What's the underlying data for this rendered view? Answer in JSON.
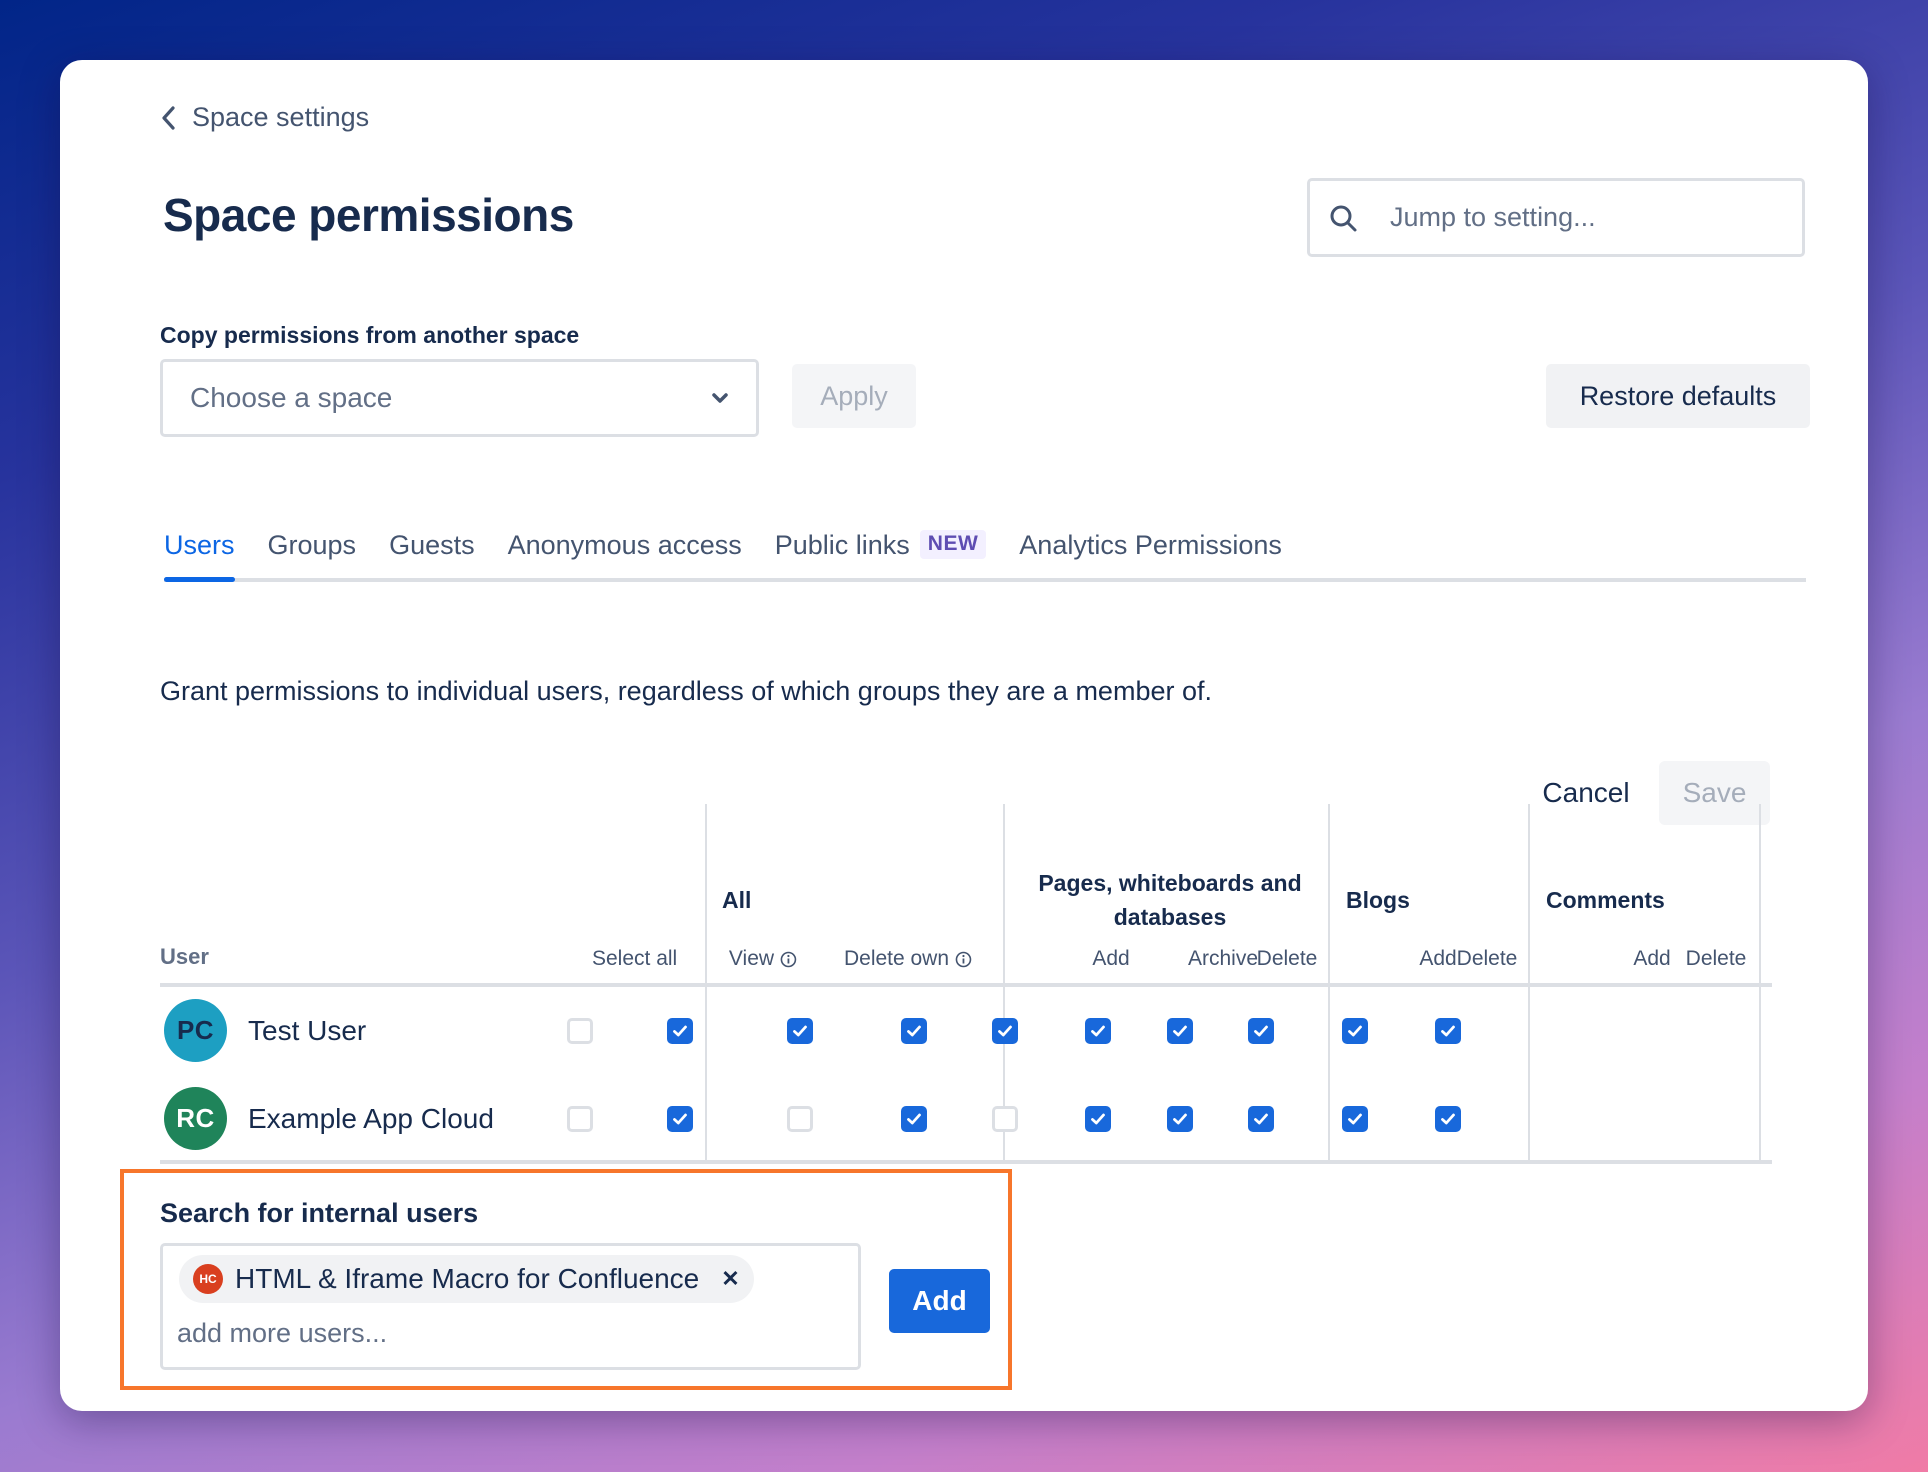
{
  "header": {
    "back_label": "Space settings",
    "title": "Space permissions",
    "search_placeholder": "Jump to setting..."
  },
  "copy_permissions": {
    "label": "Copy permissions from another space",
    "select_placeholder": "Choose a space",
    "apply_label": "Apply",
    "restore_label": "Restore defaults"
  },
  "tabs": [
    {
      "label": "Users",
      "active": true
    },
    {
      "label": "Groups",
      "active": false
    },
    {
      "label": "Guests",
      "active": false
    },
    {
      "label": "Anonymous access",
      "active": false
    },
    {
      "label": "Public links",
      "badge": "NEW",
      "active": false
    },
    {
      "label": "Analytics Permissions",
      "active": false
    }
  ],
  "description": "Grant permissions to individual users, regardless of which groups they are a member of.",
  "actions": {
    "cancel_label": "Cancel",
    "save_label": "Save"
  },
  "table": {
    "user_header": "User",
    "select_all_label": "Select all",
    "groups": [
      {
        "label": "All",
        "columns": [
          "View",
          "Delete own"
        ]
      },
      {
        "label": "Pages, whiteboards and databases",
        "columns": [
          "Add",
          "Archive",
          "Delete"
        ]
      },
      {
        "label": "Blogs",
        "columns": [
          "Add",
          "Delete"
        ]
      },
      {
        "label": "Comments",
        "columns": [
          "Add",
          "Delete"
        ]
      }
    ],
    "rows": [
      {
        "initials": "PC",
        "name": "Test User",
        "avatar_color": "#1d9fc2",
        "avatar_text_color": "#172b4d",
        "select_all": false,
        "permissions": [
          true,
          true,
          true,
          true,
          true,
          true,
          true,
          true,
          true
        ]
      },
      {
        "initials": "RC",
        "name": "Example App Cloud",
        "avatar_color": "#1f845a",
        "avatar_text_color": "#ffffff",
        "select_all": false,
        "permissions": [
          true,
          false,
          true,
          false,
          true,
          true,
          true,
          true,
          true
        ]
      }
    ]
  },
  "user_search": {
    "label": "Search for internal users",
    "selected": [
      {
        "initials": "HC",
        "name": "HTML & Iframe Macro for Confluence"
      }
    ],
    "placeholder": "add more users...",
    "add_label": "Add"
  },
  "colors": {
    "accent": "#0c66e4",
    "checkbox_checked": "#1868db",
    "highlight_border": "#f7762b",
    "new_badge_text": "#5e4db2"
  }
}
